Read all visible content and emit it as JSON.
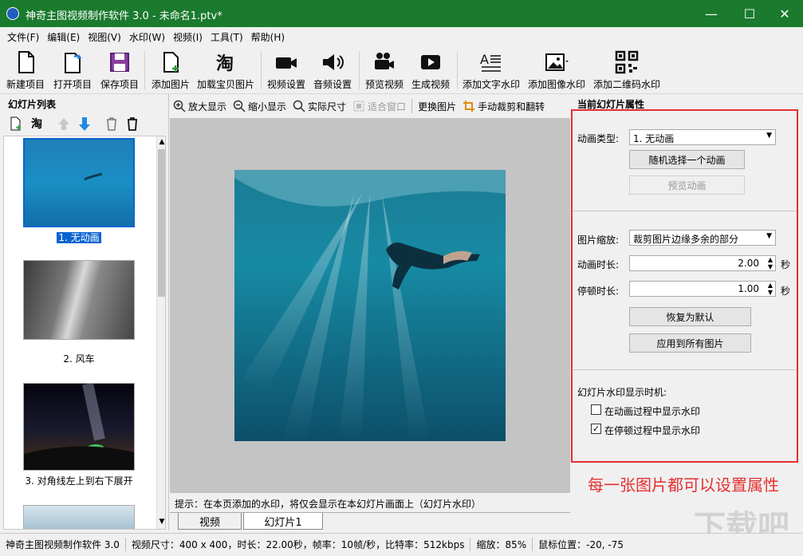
{
  "window": {
    "title": "神奇主图视频制作软件 3.0 - 未命名1.ptv*",
    "minimize": "—",
    "maximize": "☐",
    "close": "✕"
  },
  "menu": [
    "文件(F)",
    "编辑(E)",
    "视图(V)",
    "水印(W)",
    "视频(I)",
    "工具(T)",
    "帮助(H)"
  ],
  "toolbar": {
    "new": "新建项目",
    "open": "打开项目",
    "save": "保存项目",
    "add_image": "添加图片",
    "load_taobao": "加载宝贝图片",
    "video_settings": "视频设置",
    "audio_settings": "音频设置",
    "preview_video": "预览视频",
    "generate_video": "生成视频",
    "add_text_wm": "添加文字水印",
    "add_image_wm": "添加图像水印",
    "add_qr_wm": "添加二维码水印"
  },
  "left_panel": {
    "header": "幻灯片列表",
    "taobao_icon_text": "淘",
    "slides": [
      {
        "caption": "1. 无动画",
        "selected": true
      },
      {
        "caption": "2. 风车",
        "selected": false
      },
      {
        "caption": "3. 对角线左上到右下展开",
        "selected": false
      }
    ]
  },
  "center": {
    "zoom_in": "放大显示",
    "zoom_out": "缩小显示",
    "actual_size": "实际尺寸",
    "fit_window": "适合窗口",
    "replace_image": "更换图片",
    "crop_flip": "手动裁剪和翻转",
    "hint": "提示：在本页添加的水印，将仅会显示在本幻灯片画面上（幻灯片水印）",
    "tabs": [
      "视频",
      "幻灯片1"
    ]
  },
  "right_panel": {
    "header": "当前幻灯片属性",
    "animation_type_label": "动画类型:",
    "animation_type_value": "1. 无动画",
    "random_anim_button": "随机选择一个动画",
    "preview_anim_button": "预览动画",
    "image_scale_label": "图片缩放:",
    "image_scale_value": "裁剪图片边缘多余的部分",
    "anim_duration_label": "动画时长:",
    "anim_duration_value": "2.00",
    "pause_duration_label": "停顿时长:",
    "pause_duration_value": "1.00",
    "seconds_unit": "秒",
    "reset_button": "恢复为默认",
    "apply_all_button": "应用到所有图片",
    "wm_timing_label": "幻灯片水印显示时机:",
    "show_during_anim": {
      "label": "在动画过程中显示水印",
      "checked": false
    },
    "show_during_pause": {
      "label": "在停顿过程中显示水印",
      "checked": true
    }
  },
  "annotation": "每一张图片都可以设置属性",
  "status": {
    "app": "神奇主图视频制作软件 3.0",
    "video_info": "视频尺寸：400 x 400，时长：22.00秒，帧率：10帧/秒，比特率：512kbps",
    "zoom": "缩放：85%",
    "mouse": "鼠标位置：-20, -75"
  },
  "watermark_logo": "下载吧",
  "colors": {
    "titlebar": "#1a7a2e",
    "selection": "#0a64d0",
    "annotation_red": "#e53030"
  }
}
